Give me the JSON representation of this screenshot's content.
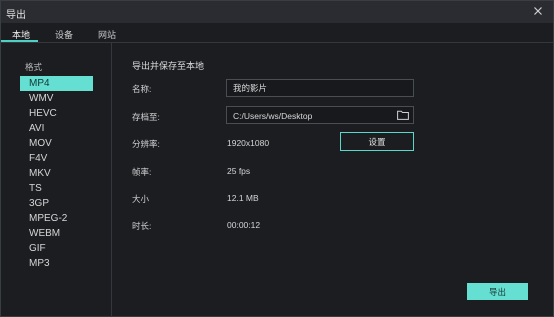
{
  "window": {
    "title": "导出"
  },
  "tabs": [
    {
      "label": "本地"
    },
    {
      "label": "设备"
    },
    {
      "label": "网站"
    }
  ],
  "sidebar": {
    "heading": "格式",
    "formats": [
      "MP4",
      "WMV",
      "HEVC",
      "AVI",
      "MOV",
      "F4V",
      "MKV",
      "TS",
      "3GP",
      "MPEG-2",
      "WEBM",
      "GIF",
      "MP3"
    ],
    "selected": "MP4"
  },
  "main": {
    "section_title": "导出并保存至本地",
    "name": {
      "label": "名称:",
      "value": "我的影片"
    },
    "save_to": {
      "label": "存档至:",
      "value": "C:/Users/ws/Desktop"
    },
    "resolution": {
      "label": "分辨率:",
      "value": "1920x1080",
      "settings_label": "设置"
    },
    "frame_rate": {
      "label": "帧率:",
      "value": "25 fps"
    },
    "size": {
      "label": "大小",
      "value": "12.1 MB"
    },
    "duration": {
      "label": "时长:",
      "value": "00:00:12"
    }
  },
  "footer": {
    "export_label": "导出"
  },
  "colors": {
    "accent": "#66dfd3",
    "background": "#1b1d21"
  }
}
